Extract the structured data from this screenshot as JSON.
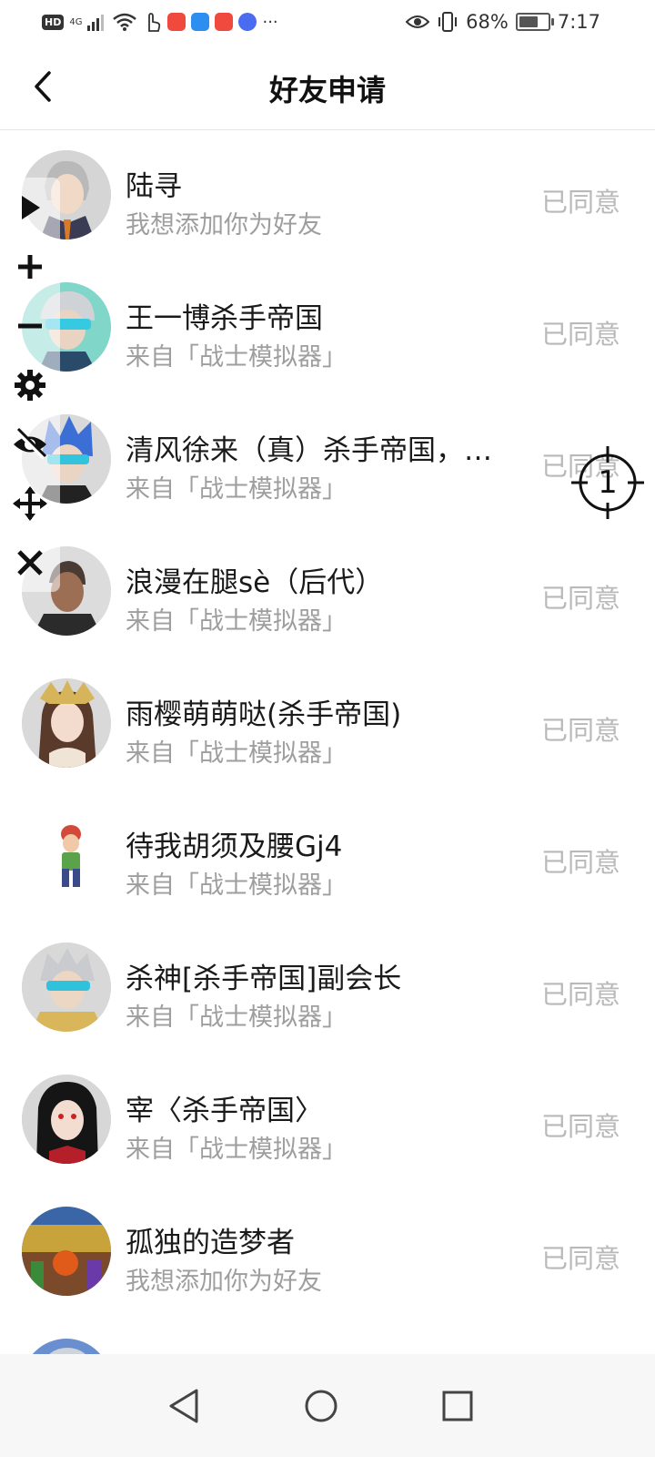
{
  "status_bar": {
    "left_indicators": [
      "HD",
      "4G"
    ],
    "battery_text": "68%",
    "battery_level": 0.68,
    "time": "7:17",
    "more": "···",
    "icons": [
      "signal-icon",
      "wifi-icon",
      "touch-icon",
      "app-notification-icon",
      "eye-icon",
      "vibrate-icon",
      "battery-icon"
    ]
  },
  "header": {
    "title": "好友申请",
    "back_icon": "chevron-left-icon"
  },
  "requests": [
    {
      "name": "陆寻",
      "message": "我想添加你为好友",
      "status": "已同意",
      "avatar": "anime-character-white-hair"
    },
    {
      "name": "王一博杀手帝国",
      "message": "来自「战士模拟器」",
      "status": "已同意",
      "avatar": "character-cyan-visor"
    },
    {
      "name": "清风徐来（真）杀手帝国，…",
      "message": "来自「战士模拟器」",
      "status": "已同意",
      "avatar": "character-blue-spiky-hair"
    },
    {
      "name": "浪漫在腿sè（后代）",
      "message": "来自「战士模拟器」",
      "status": "已同意",
      "avatar": "character-dark-skin"
    },
    {
      "name": "雨樱萌萌哒(杀手帝国)",
      "message": "来自「战士模拟器」",
      "status": "已同意",
      "avatar": "anime-girl-gold-crown"
    },
    {
      "name": "待我胡须及腰Gj4",
      "message": "来自「战士模拟器」",
      "status": "已同意",
      "avatar": "small-pixel-character"
    },
    {
      "name": "杀神[杀手帝国]副会长",
      "message": "来自「战士模拟器」",
      "status": "已同意",
      "avatar": "character-silver-hair-visor"
    },
    {
      "name": "宰〈杀手帝国〉",
      "message": "来自「战士模拟器」",
      "status": "已同意",
      "avatar": "anime-black-hair"
    },
    {
      "name": "孤独的造梦者",
      "message": "我想添加你为好友",
      "status": "已同意",
      "avatar": "colorful-scene"
    }
  ],
  "overlay_toolbar": {
    "tools": [
      "play-icon",
      "plus-icon",
      "minus-icon",
      "gear-icon",
      "eye-off-icon",
      "move-icon",
      "close-icon"
    ]
  },
  "crosshair": {
    "label": "1"
  },
  "nav_bar": {
    "buttons": [
      "back-triangle-icon",
      "home-circle-icon",
      "recents-square-icon"
    ]
  },
  "colors": {
    "status_text": "#b9b9b9",
    "subtitle_text": "#9e9e9e",
    "name_text": "#1a1a1a",
    "divider": "#e6e6e6"
  }
}
